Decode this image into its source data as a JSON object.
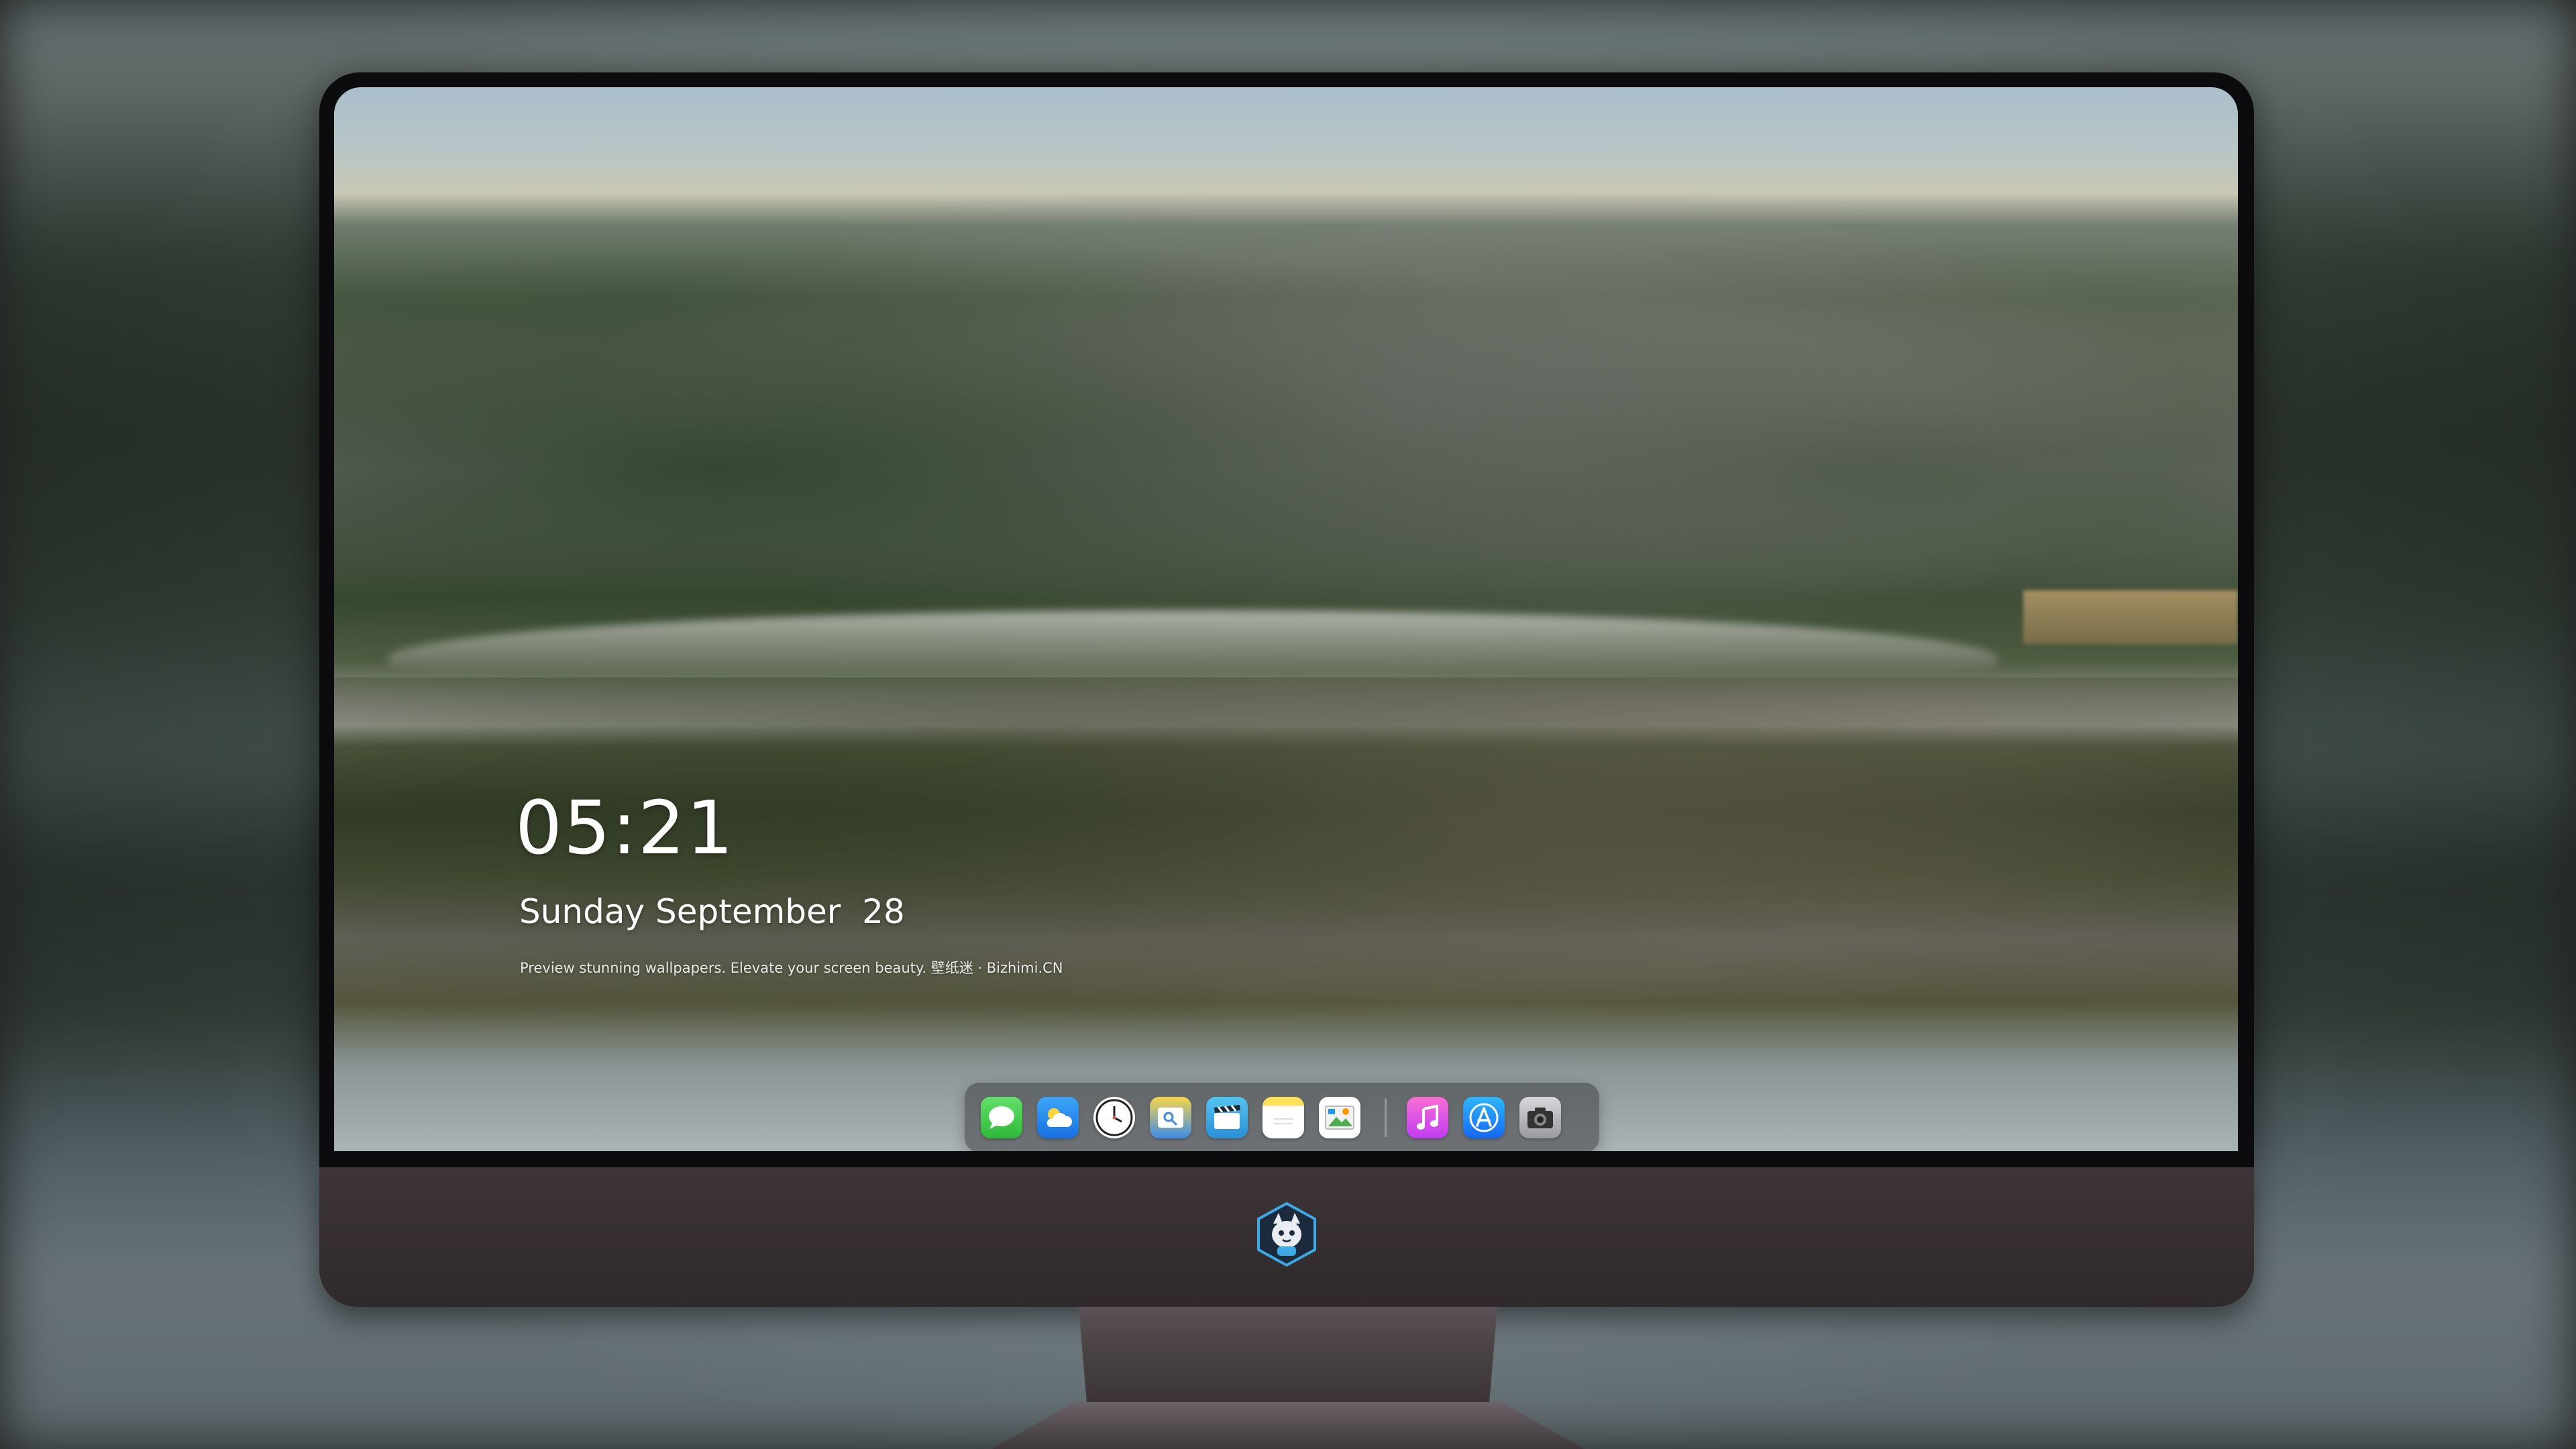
{
  "lock_screen": {
    "time": "05:21",
    "date": "Sunday September  28",
    "tagline": "Preview stunning wallpapers. Elevate your screen beauty. 壁纸迷 · Bizhimi.CN"
  },
  "dock": {
    "apps": [
      {
        "name": "Messages",
        "icon": "messages-icon"
      },
      {
        "name": "Weather",
        "icon": "weather-icon"
      },
      {
        "name": "Clock",
        "icon": "clock-icon"
      },
      {
        "name": "Finder",
        "icon": "finder-icon"
      },
      {
        "name": "Clips",
        "icon": "clips-icon"
      },
      {
        "name": "Notes",
        "icon": "notes-icon"
      },
      {
        "name": "Photos",
        "icon": "photos-icon"
      },
      {
        "name": "Music",
        "icon": "music-icon"
      },
      {
        "name": "App Store",
        "icon": "app-store-icon"
      },
      {
        "name": "Camera",
        "icon": "camera-icon"
      }
    ]
  },
  "monitor": {
    "logo": "fox-mascot-logo-icon"
  },
  "colors": {
    "bezel": "#0c0c0e",
    "chin": "#3d3538",
    "dock_bg": "rgba(60,60,62,0.55)",
    "text": "#ffffff"
  }
}
